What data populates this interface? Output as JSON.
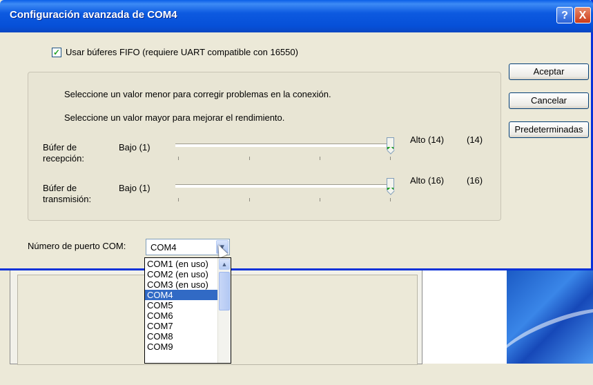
{
  "window": {
    "title": "Configuración avanzada de COM4",
    "help_glyph": "?",
    "close_glyph": "X"
  },
  "fifo": {
    "checked": true,
    "label": "Usar búferes FIFO (requiere UART compatible con 16550)"
  },
  "help": {
    "line1": "Seleccione un valor menor para corregir problemas en la conexión.",
    "line2": "Seleccione un valor mayor para mejorar el rendimiento."
  },
  "receive": {
    "label": "Búfer de recepción:",
    "low": "Bajo (1)",
    "high": "Alto (14)",
    "value": "(14)",
    "level": 14,
    "max": 14
  },
  "transmit": {
    "label": "Búfer de transmisión:",
    "low": "Bajo (1)",
    "high": "Alto (16)",
    "value": "(16)",
    "level": 16,
    "max": 16
  },
  "buttons": {
    "ok": "Aceptar",
    "cancel": "Cancelar",
    "defaults": "Predeterminadas"
  },
  "port": {
    "label": "Número de puerto COM:",
    "selected": "COM4",
    "options": [
      "COM1 (en uso)",
      "COM2 (en uso)",
      "COM3 (en uso)",
      "COM4",
      "COM5",
      "COM6",
      "COM7",
      "COM8",
      "COM9"
    ],
    "selected_index": 3
  },
  "colors": {
    "titlebar": "#0a5fe8",
    "selection": "#316ac5",
    "check": "#21a121"
  }
}
